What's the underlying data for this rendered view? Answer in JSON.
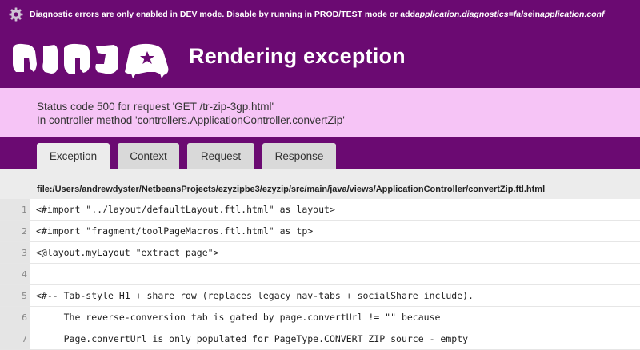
{
  "notice": {
    "text_prefix": "Diagnostic errors are only enabled in DEV mode. Disable by running in PROD/TEST mode or add ",
    "setting": "application.diagnostics=false",
    "text_mid": " in ",
    "file": "application.conf"
  },
  "logo": {
    "text": "NINJA"
  },
  "title": "Rendering exception",
  "status": {
    "line1": "Status code 500 for request 'GET /tr-zip-3gp.html'",
    "line2": "In controller method 'controllers.ApplicationController.convertZip'"
  },
  "tabs": [
    {
      "label": "Exception",
      "active": true
    },
    {
      "label": "Context",
      "active": false
    },
    {
      "label": "Request",
      "active": false
    },
    {
      "label": "Response",
      "active": false
    }
  ],
  "file_path": "file:/Users/andrewdyster/NetbeansProjects/ezyzipbe3/ezyzip/src/main/java/views/ApplicationController/convertZip.ftl.html",
  "code_lines": [
    {
      "num": "1",
      "text": "<#import \"../layout/defaultLayout.ftl.html\" as layout>"
    },
    {
      "num": "2",
      "text": "<#import \"fragment/toolPageMacros.ftl.html\" as tp>"
    },
    {
      "num": "3",
      "text": "<@layout.myLayout \"extract page\">"
    },
    {
      "num": "4",
      "text": ""
    },
    {
      "num": "5",
      "text": "<#-- Tab-style H1 + share row (replaces legacy nav-tabs + socialShare include)."
    },
    {
      "num": "6",
      "text": "     The reverse-conversion tab is gated by page.convertUrl != \"\" because"
    },
    {
      "num": "7",
      "text": "     Page.convertUrl is only populated for PageType.CONVERT_ZIP source - empty"
    }
  ],
  "colors": {
    "header": "#6b0a72",
    "status_bg": "#f6c4f6",
    "page_bg": "#ececec"
  }
}
